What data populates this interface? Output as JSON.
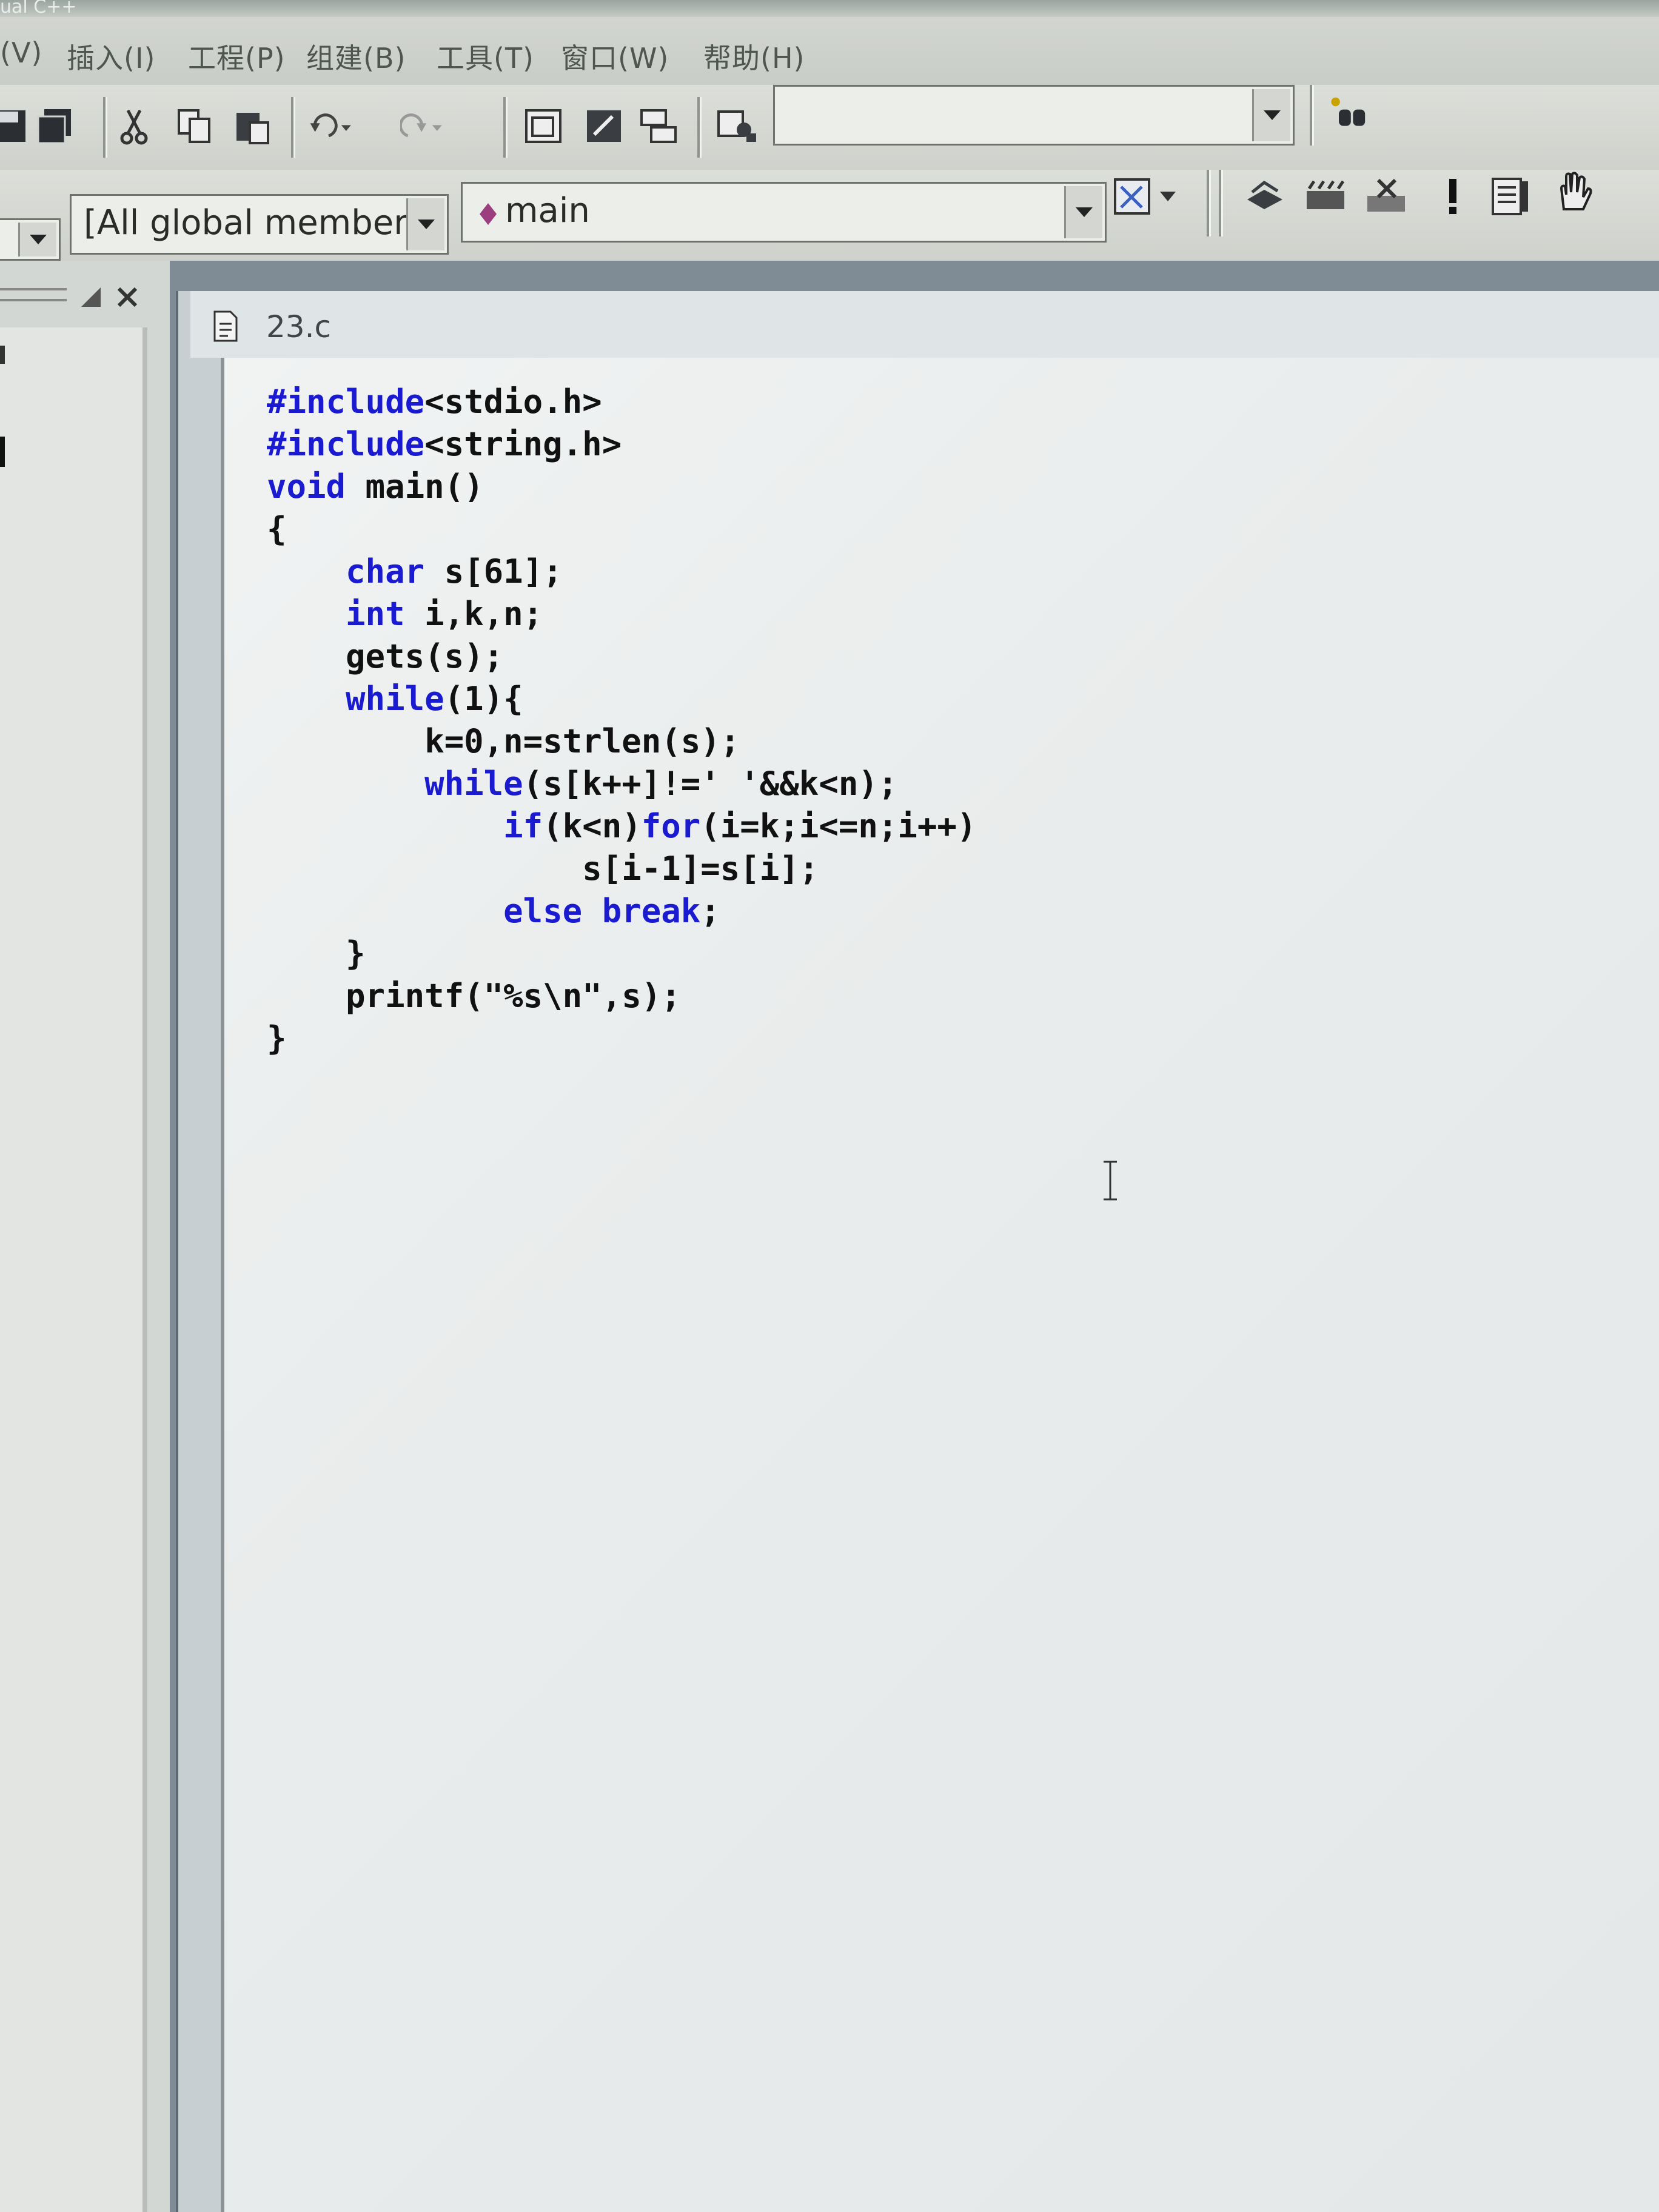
{
  "window": {
    "title": "ual C++"
  },
  "menu": {
    "items": [
      "(V)",
      "插入(I)",
      "工程(P)",
      "组建(B)",
      "工具(T)",
      "窗口(W)",
      "帮助(H)"
    ]
  },
  "toolbar": {
    "find_combo_value": "",
    "members_combo_value": "[All global members",
    "function_combo_value": "main"
  },
  "editor": {
    "tab_title": "23.c",
    "code_lines": [
      {
        "indent": "",
        "parts": [
          {
            "t": "#include",
            "c": "pre"
          },
          {
            "t": "<stdio.h>",
            "c": ""
          }
        ]
      },
      {
        "indent": "",
        "parts": [
          {
            "t": "#include",
            "c": "pre"
          },
          {
            "t": "<string.h>",
            "c": ""
          }
        ]
      },
      {
        "indent": "",
        "parts": [
          {
            "t": "void",
            "c": "kw"
          },
          {
            "t": " main()",
            "c": ""
          }
        ]
      },
      {
        "indent": "",
        "parts": [
          {
            "t": "{",
            "c": ""
          }
        ]
      },
      {
        "indent": "    ",
        "parts": [
          {
            "t": "char",
            "c": "kw"
          },
          {
            "t": " s[61];",
            "c": ""
          }
        ]
      },
      {
        "indent": "    ",
        "parts": [
          {
            "t": "int",
            "c": "kw"
          },
          {
            "t": " i,k,n;",
            "c": ""
          }
        ]
      },
      {
        "indent": "    ",
        "parts": [
          {
            "t": "gets(s);",
            "c": ""
          }
        ]
      },
      {
        "indent": "    ",
        "parts": [
          {
            "t": "while",
            "c": "kw"
          },
          {
            "t": "(1){",
            "c": ""
          }
        ]
      },
      {
        "indent": "        ",
        "parts": [
          {
            "t": "k=0,n=strlen(s);",
            "c": ""
          }
        ]
      },
      {
        "indent": "        ",
        "parts": [
          {
            "t": "while",
            "c": "kw"
          },
          {
            "t": "(s[k++]!=' '&&k<n);",
            "c": ""
          }
        ]
      },
      {
        "indent": "            ",
        "parts": [
          {
            "t": "if",
            "c": "kw"
          },
          {
            "t": "(k<n)",
            "c": ""
          },
          {
            "t": "for",
            "c": "kw"
          },
          {
            "t": "(i=k;i<=n;i++)",
            "c": ""
          }
        ]
      },
      {
        "indent": "                ",
        "parts": [
          {
            "t": "s[i-1]=s[i];",
            "c": ""
          }
        ]
      },
      {
        "indent": "            ",
        "parts": [
          {
            "t": "else",
            "c": "kw"
          },
          {
            "t": " ",
            "c": ""
          },
          {
            "t": "break",
            "c": "kw"
          },
          {
            "t": ";",
            "c": ""
          }
        ]
      },
      {
        "indent": "    ",
        "parts": [
          {
            "t": "}",
            "c": ""
          }
        ]
      },
      {
        "indent": "    ",
        "parts": [
          {
            "t": "printf(\"%s\\n\",s);",
            "c": ""
          }
        ]
      },
      {
        "indent": "",
        "parts": [
          {
            "t": "}",
            "c": ""
          }
        ]
      }
    ]
  },
  "icons": {
    "toolbar1": [
      "save-icon",
      "save-all-icon",
      "cut-icon",
      "copy-icon",
      "paste-icon",
      "undo-icon",
      "redo-icon",
      "workspace-icon",
      "output-icon",
      "window-list-icon",
      "find-in-files-icon",
      "find-icon"
    ],
    "toolbar2": [
      "class-wizard-icon",
      "compile-icon",
      "build-icon",
      "stop-build-icon",
      "execute-icon",
      "go-icon",
      "breakpoint-icon"
    ]
  }
}
